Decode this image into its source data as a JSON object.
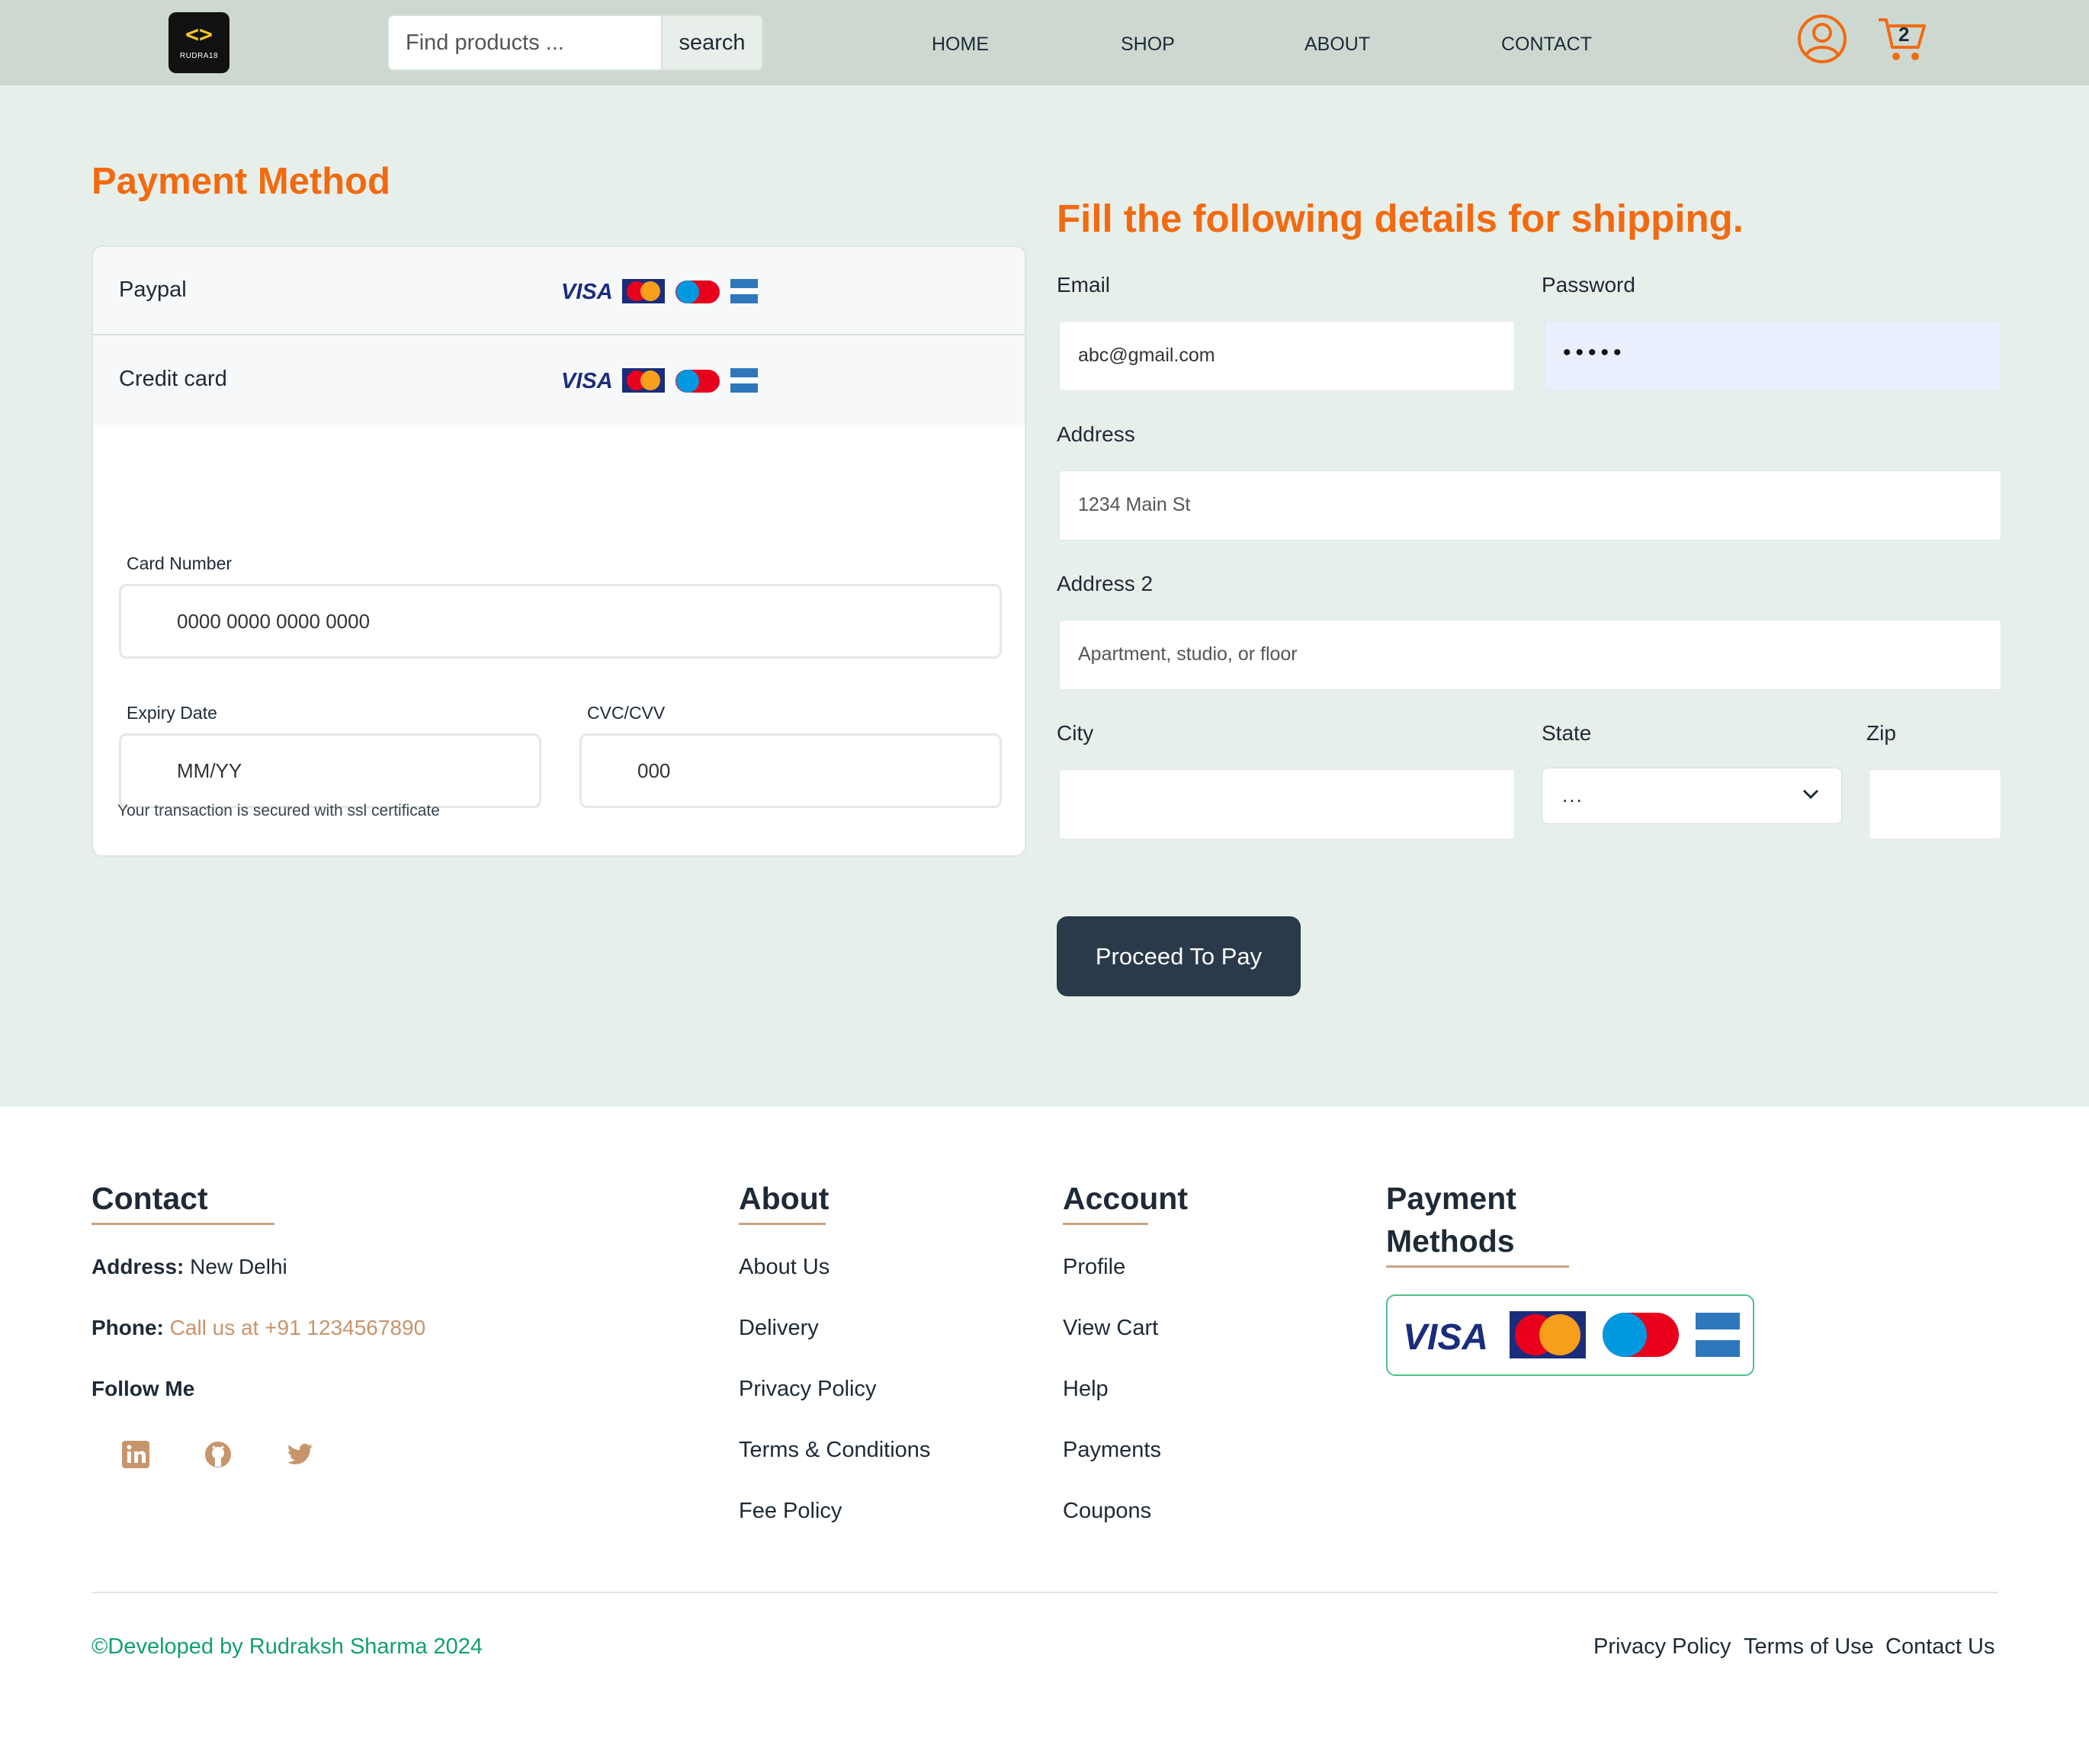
{
  "header": {
    "logo_text": "RUDRA18",
    "search": {
      "placeholder": "Find products ...",
      "button_label": "search"
    },
    "nav": [
      "HOME",
      "SHOP",
      "ABOUT",
      "CONTACT"
    ],
    "cart_count": "2"
  },
  "payment": {
    "title": "Payment Method",
    "methods": [
      "Paypal",
      "Credit card"
    ],
    "card_brands": [
      "VISA",
      "MasterCard",
      "Maestro",
      "AMERICAN EXPRESS"
    ],
    "card_number_label": "Card Number",
    "card_number_placeholder": "0000 0000 0000 0000",
    "expiry_label": "Expiry Date",
    "expiry_placeholder": "MM/YY",
    "cvc_label": "CVC/CVV",
    "cvc_placeholder": "000",
    "ssl_note": "Your transaction is secured with ssl certificate"
  },
  "shipping": {
    "title": "Fill the following details for shipping.",
    "email_label": "Email",
    "email_value": "abc@gmail.com",
    "password_label": "Password",
    "password_value": "•••••",
    "address_label": "Address",
    "address_placeholder": "1234 Main St",
    "address2_label": "Address 2",
    "address2_placeholder": "Apartment, studio, or floor",
    "city_label": "City",
    "city_value": "",
    "state_label": "State",
    "state_selected": "...",
    "zip_label": "Zip",
    "zip_value": "",
    "submit_label": "Proceed To Pay"
  },
  "footer": {
    "contact": {
      "heading": "Contact",
      "address_label": "Address:",
      "address_value": "New Delhi",
      "phone_label": "Phone:",
      "phone_value": "Call us at +91 1234567890",
      "follow_label": "Follow Me",
      "social_icons": [
        "linkedin-icon",
        "github-icon",
        "twitter-icon"
      ]
    },
    "about": {
      "heading": "About",
      "links": [
        "About Us",
        "Delivery",
        "Privacy Policy",
        "Terms & Conditions",
        "Fee Policy"
      ]
    },
    "account": {
      "heading": "Account",
      "links": [
        "Profile",
        "View Cart",
        "Help",
        "Payments",
        "Coupons"
      ]
    },
    "payment_methods": {
      "heading_line1": "Payment",
      "heading_line2": "Methods"
    },
    "copyright": "©Developed by Rudraksh Sharma 2024",
    "bottom_links": [
      "Privacy Policy",
      "Terms of Use",
      "Contact Us"
    ]
  },
  "colors": {
    "accent_orange": "#f26a10",
    "header_bg": "#cdd9d0",
    "main_bg": "#e7efea",
    "button_dark": "#2b3a4a",
    "footer_accent": "#c9a27e",
    "copyright_green": "#13a06b"
  }
}
